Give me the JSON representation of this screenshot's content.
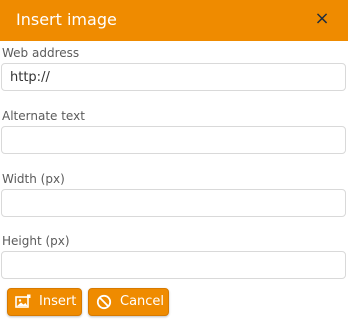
{
  "dialog": {
    "title": "Insert image",
    "close_icon": "close-icon",
    "close_glyph": "×"
  },
  "fields": {
    "web_address": {
      "label": "Web address",
      "value": "http://"
    },
    "alternate_text": {
      "label": "Alternate text",
      "value": ""
    },
    "width": {
      "label": "Width (px)",
      "value": ""
    },
    "height": {
      "label": "Height (px)",
      "value": ""
    }
  },
  "buttons": {
    "insert": {
      "label": "Insert",
      "icon": "insert-image-icon"
    },
    "cancel": {
      "label": "Cancel",
      "icon": "cancel-icon"
    }
  },
  "colors": {
    "accent": "#ef8b00",
    "close": "#1f2d3d"
  }
}
